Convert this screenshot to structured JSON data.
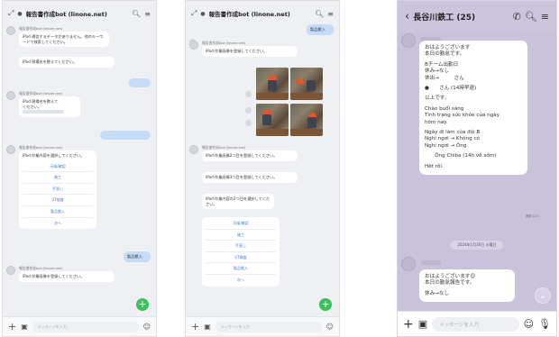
{
  "phone1": {
    "title": "報告書作成bot (linone.net)",
    "input_placeholder": "メッセージを入力",
    "sender": "報告書作成bot (linone.net)",
    "msg1": "iPad 通信するデータがありません。他のキーワードで検索してください。",
    "msg2": "iPad 現場名を教えてください。",
    "msg3": "iPad 現場名を教えて",
    "msg3b": "ください。",
    "msg4": "iPad 作業内容を選択してください。",
    "options": [
      "天候/確認",
      "施工",
      "手直し",
      "UT検査",
      "製品搬入",
      "次へ"
    ],
    "right1": "",
    "right2": "",
    "right3": "製品搬入",
    "msg5": "iPad 作業画像を登録してください。"
  },
  "phone2": {
    "title": "報告書作成bot (linone.net)",
    "input_placeholder": "メッセージを入力",
    "sender": "報告書作成bot (linone.net)",
    "right1": "製品搬入",
    "msg1": "iPad 作業画像を登録してください。",
    "msg2": "iPad 作業画像2つ目を登録してください。",
    "msg3": "iPad 作業画像3つ目を登録してください。",
    "msg4": "iPad 作業内容の2つ目を選択してください。",
    "options": [
      "天候/確認",
      "施工",
      "手直し",
      "UT検査",
      "製品搬入",
      "次へ"
    ]
  },
  "phone3": {
    "title": "長谷川鉄工 (25)",
    "input_placeholder": "メッセージを入力",
    "bubble1": [
      "おはようございます",
      "本日の勤怠です。",
      "",
      "Bチーム出勤日",
      "休み→なし",
      "休出→　　　さん",
      "",
      "●　　さん (14時早退)",
      "",
      "以上です。",
      "",
      "Chào buổi sáng",
      "Tình trạng sức khỏe của ngày",
      "hôm nay.",
      "",
      "Ngày đi làm của đội B",
      "Nghỉ ngơi → Không có",
      "Nghỉ ngơi → Ông",
      "",
      "　　Ông Chiba (14h về sớm)",
      "",
      "Hết rồi."
    ],
    "time1": "既読 22人",
    "date_chip": "2024年1月30日 火曜日",
    "bubble2": [
      "おはようございます😊",
      "本日の勤怠報告です。",
      "",
      "休み→なし"
    ]
  },
  "icons": {
    "expand": "expand-icon",
    "search": "search-icon",
    "menu": "menu-icon",
    "plus": "plus-icon",
    "image": "image-icon",
    "emoji": "emoji-icon",
    "back": "back-icon",
    "call": "phone-icon",
    "mic": "mic-icon"
  },
  "colors": {
    "line_green": "#39c25a",
    "bubble_right": "#c4dcf8",
    "p3_bg": "#c9c2da",
    "option_link": "#4a79c6"
  }
}
